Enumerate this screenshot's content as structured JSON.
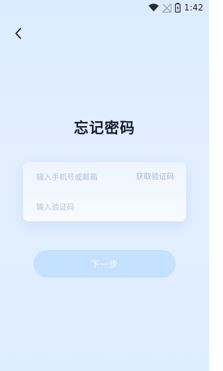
{
  "status_bar": {
    "time": "1:42",
    "icons": [
      "wifi-icon",
      "no-signal-icon",
      "battery-icon"
    ]
  },
  "navigation": {
    "back_icon": "chevron-left-icon"
  },
  "page": {
    "title": "忘记密码"
  },
  "form": {
    "account_placeholder": "输入手机号或邮箱",
    "get_code_label": "获取验证码",
    "code_placeholder": "输入验证码"
  },
  "actions": {
    "next_label": "下一步"
  },
  "colors": {
    "background": "#dcebff",
    "title": "#151c2e",
    "placeholder": "#b4c3d6",
    "button_disabled": "#c4e2ff"
  }
}
